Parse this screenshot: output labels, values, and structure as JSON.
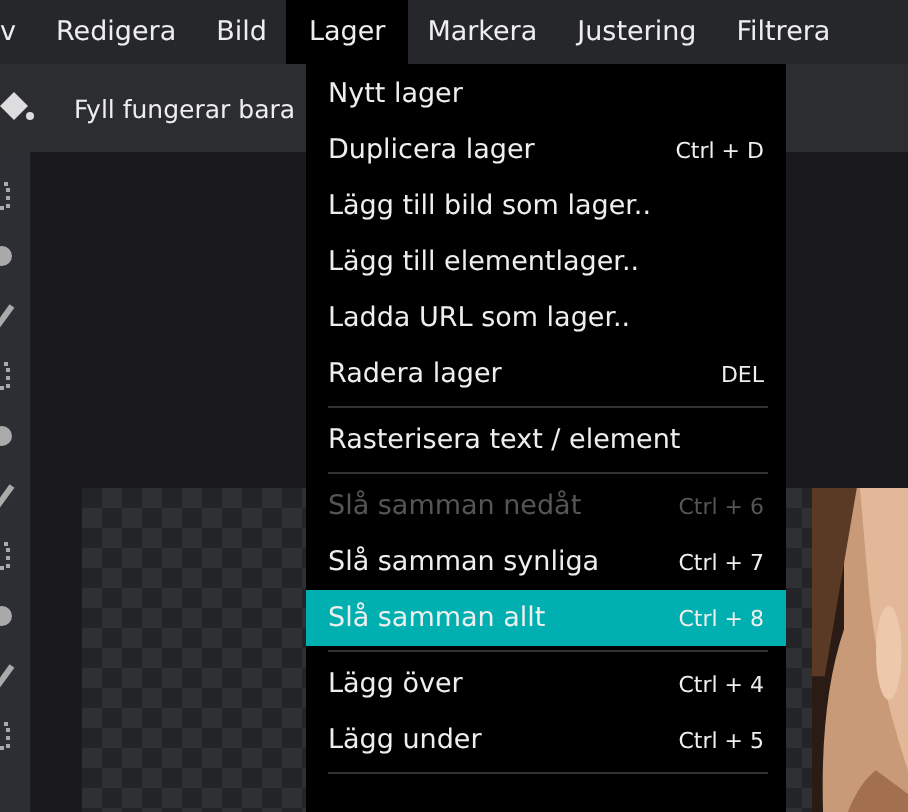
{
  "menubar": [
    {
      "label": "v",
      "selected": false
    },
    {
      "label": "Redigera",
      "selected": false
    },
    {
      "label": "Bild",
      "selected": false
    },
    {
      "label": "Lager",
      "selected": true
    },
    {
      "label": "Markera",
      "selected": false
    },
    {
      "label": "Justering",
      "selected": false
    },
    {
      "label": "Filtrera",
      "selected": false
    }
  ],
  "info_bar": {
    "message": "Fyll fungerar bara"
  },
  "menu": [
    {
      "kind": "item",
      "label": "Nytt lager",
      "disabled": false,
      "selected": false
    },
    {
      "kind": "item",
      "label": "Duplicera lager",
      "shortcut": "Ctrl + D",
      "disabled": false,
      "selected": false
    },
    {
      "kind": "item",
      "label": "Lägg till bild som lager..",
      "disabled": false,
      "selected": false
    },
    {
      "kind": "item",
      "label": "Lägg till elementlager..",
      "disabled": false,
      "selected": false
    },
    {
      "kind": "item",
      "label": "Ladda URL som lager..",
      "disabled": false,
      "selected": false
    },
    {
      "kind": "item",
      "label": "Radera lager",
      "shortcut": "DEL",
      "disabled": false,
      "selected": false
    },
    {
      "kind": "divider"
    },
    {
      "kind": "item",
      "label": "Rasterisera text / element",
      "disabled": false,
      "selected": false
    },
    {
      "kind": "divider"
    },
    {
      "kind": "item",
      "label": "Slå samman nedåt",
      "shortcut": "Ctrl + 6",
      "disabled": true,
      "selected": false
    },
    {
      "kind": "item",
      "label": "Slå samman synliga",
      "shortcut": "Ctrl + 7",
      "disabled": false,
      "selected": false
    },
    {
      "kind": "item",
      "label": "Slå samman allt",
      "shortcut": "Ctrl + 8",
      "disabled": false,
      "selected": true
    },
    {
      "kind": "divider"
    },
    {
      "kind": "item",
      "label": "Lägg över",
      "shortcut": "Ctrl + 4",
      "disabled": false,
      "selected": false
    },
    {
      "kind": "item",
      "label": "Lägg under",
      "shortcut": "Ctrl + 5",
      "disabled": false,
      "selected": false
    },
    {
      "kind": "divider"
    }
  ]
}
